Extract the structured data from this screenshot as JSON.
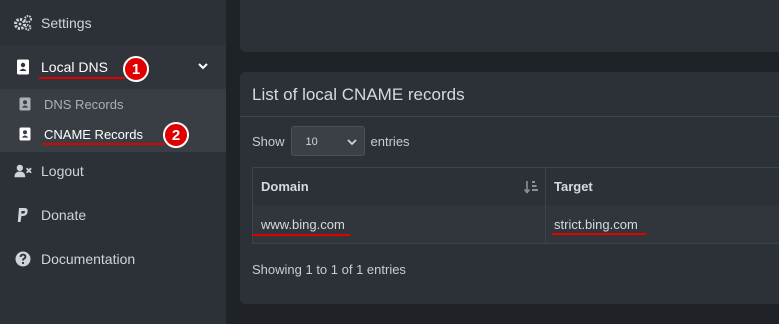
{
  "sidebar": {
    "settings": {
      "label": "Settings",
      "icon": "gears-icon"
    },
    "local_dns": {
      "label": "Local DNS",
      "icon": "address-book-icon"
    },
    "dns_records": {
      "label": "DNS Records",
      "icon": "address-book-icon"
    },
    "cname_records": {
      "label": "CNAME Records",
      "icon": "address-book-icon"
    },
    "logout": {
      "label": "Logout",
      "icon": "user-times-icon"
    },
    "donate": {
      "label": "Donate",
      "icon": "paypal-icon"
    },
    "documentation": {
      "label": "Documentation",
      "icon": "question-circle-icon"
    }
  },
  "annotations": {
    "badge1": "1",
    "badge2": "2",
    "color": "#e00000"
  },
  "main": {
    "card_title": "List of local CNAME records",
    "show_label": "Show",
    "entries_select_value": "10",
    "entries_label": "entries",
    "table": {
      "columns": [
        "Domain",
        "Target"
      ],
      "rows": [
        {
          "domain": "www.bing.com",
          "target": "strict.bing.com"
        }
      ]
    },
    "info_text": "Showing 1 to 1 of 1 entries"
  }
}
